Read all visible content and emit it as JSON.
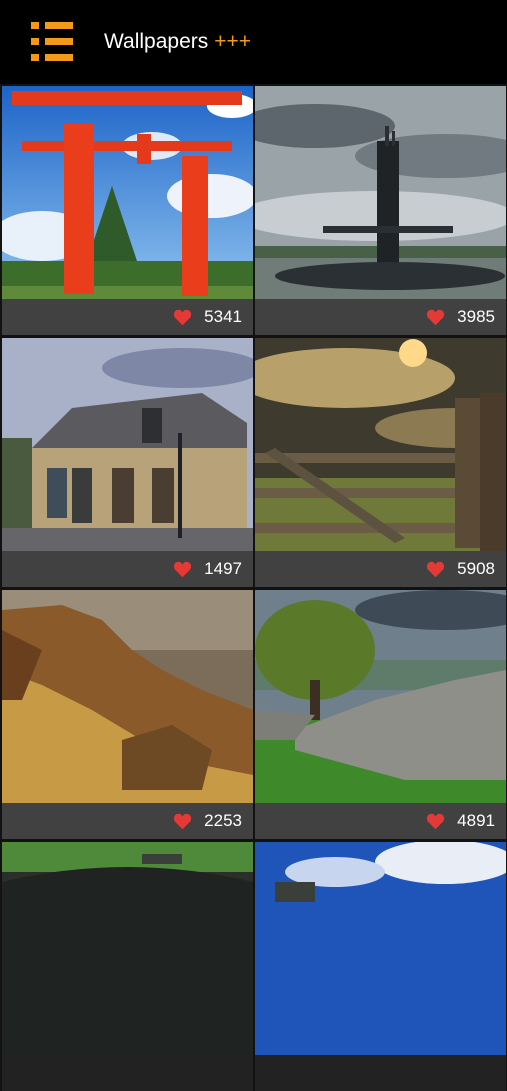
{
  "appbar": {
    "icon": "menu-list-icon",
    "title": "Wallpapers",
    "title_suffix": "+++",
    "accent": "#f39a1b"
  },
  "tiles": [
    {
      "likes": "5341",
      "subject": "torii-gate"
    },
    {
      "likes": "3985",
      "subject": "submarine"
    },
    {
      "likes": "1497",
      "subject": "old-house"
    },
    {
      "likes": "5908",
      "subject": "fence-sunset"
    },
    {
      "likes": "2253",
      "subject": "cliffs"
    },
    {
      "likes": "4891",
      "subject": "stone-wall-tree"
    },
    {
      "likes": "",
      "subject": "car-interior"
    },
    {
      "likes": "",
      "subject": "sky-vehicle"
    }
  ],
  "heart_color": "#e53935"
}
